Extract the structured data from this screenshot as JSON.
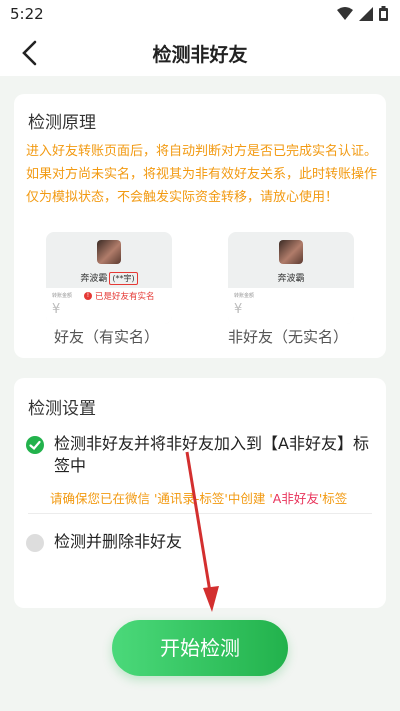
{
  "status_bar": {
    "time": "5:22"
  },
  "header": {
    "title": "检测非好友"
  },
  "principle": {
    "title": "检测原理",
    "text": "进入好友转账页面后，将自动判断对方是否已完成实名认证。如果对方尚未实名，将视其为非有效好友关系，此时转账操作仅为模拟状态，不会触发实际资金转移，请放心使用！",
    "left_preview": {
      "name": "奔波霸",
      "masked": "(**宇)",
      "small_label": "转账金额",
      "currency": "¥",
      "warning": "已是好友有实名",
      "caption": "好友（有实名）"
    },
    "right_preview": {
      "name": "奔波霸",
      "small_label": "转账金额",
      "currency": "¥",
      "caption": "非好友（无实名）"
    }
  },
  "settings": {
    "title": "检测设置",
    "option1": {
      "label": "检测非好友并将非好友加入到【A非好友】标签中",
      "checked": true,
      "note_prefix": "请确保您已在微信 '通讯录-标签'中创建 '",
      "note_highlight": "A非好友",
      "note_suffix": "'标签"
    },
    "option2": {
      "label": "检测并删除非好友",
      "checked": false
    }
  },
  "start_button": {
    "label": "开始检测"
  },
  "colors": {
    "accent": "#22b24c",
    "warning": "#f29a12",
    "alert": "#e53935"
  }
}
